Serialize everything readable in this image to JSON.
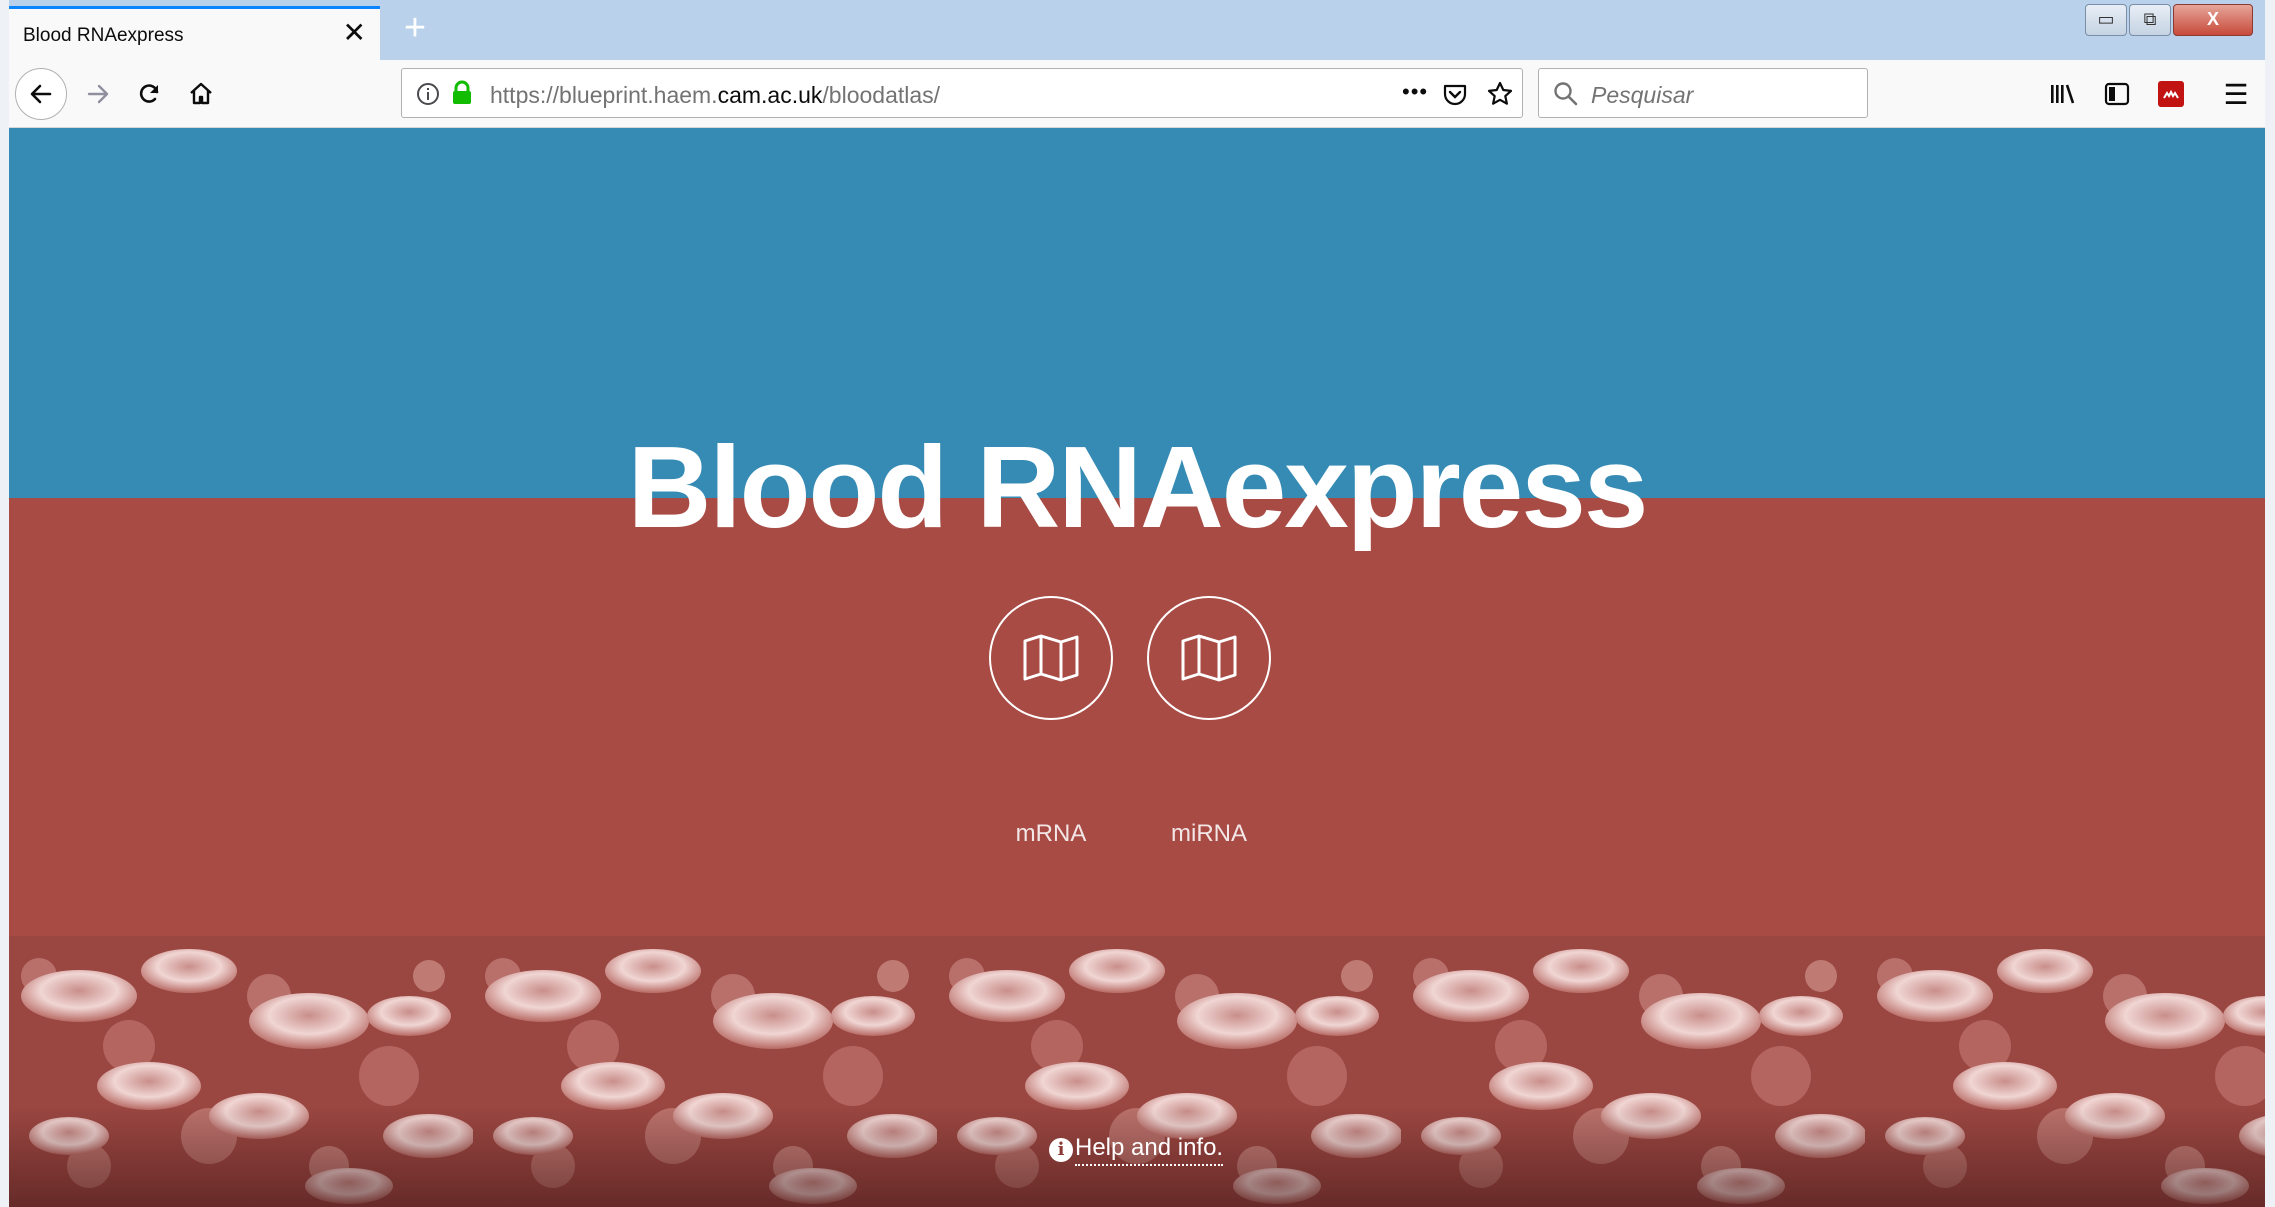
{
  "browser": {
    "tab": {
      "title": "Blood RNAexpress",
      "close_glyph": "✕"
    },
    "new_tab_glyph": "+",
    "window_controls": {
      "minimize_glyph": "▭",
      "restore_glyph": "⧉",
      "close_glyph": "X"
    },
    "url": {
      "prefix": "https://blueprint.haem.",
      "domain": "cam.ac.uk",
      "suffix": "/bloodatlas/"
    },
    "page_actions_glyph": "•••",
    "search": {
      "placeholder": "Pesquisar"
    },
    "menu_glyph": "☰"
  },
  "page": {
    "title": "Blood RNAexpress",
    "buttons": [
      {
        "label": "mRNA",
        "icon": "map-icon"
      },
      {
        "label": "miRNA",
        "icon": "map-icon"
      }
    ],
    "help": {
      "icon_glyph": "i",
      "text": "Help and info."
    }
  },
  "colors": {
    "hero_blue": "#368bb4",
    "hero_red": "#a84b45",
    "cells_tint": "#9a4641",
    "cell_light": "#e3c3c1",
    "text_white": "#ffffff"
  }
}
